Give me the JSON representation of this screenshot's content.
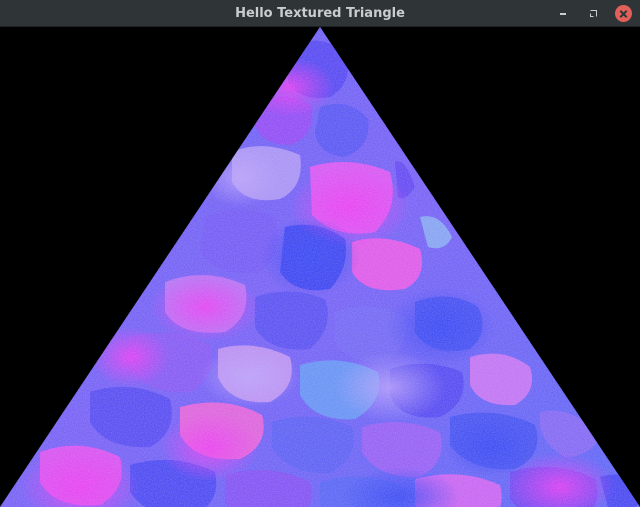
{
  "window": {
    "title": "Hello Textured Triangle",
    "minimize_icon": "minimize-icon",
    "maximize_icon": "restore-icon",
    "close_icon": "close-icon",
    "close_color": "#e0605a",
    "titlebar_color": "#2f3437"
  },
  "scene": {
    "background_color": "#000000",
    "texture": "stone-wall",
    "texture_colors": [
      "#3b3cf2",
      "#7a3cf4",
      "#e02cf0",
      "#5fb0f5"
    ]
  }
}
